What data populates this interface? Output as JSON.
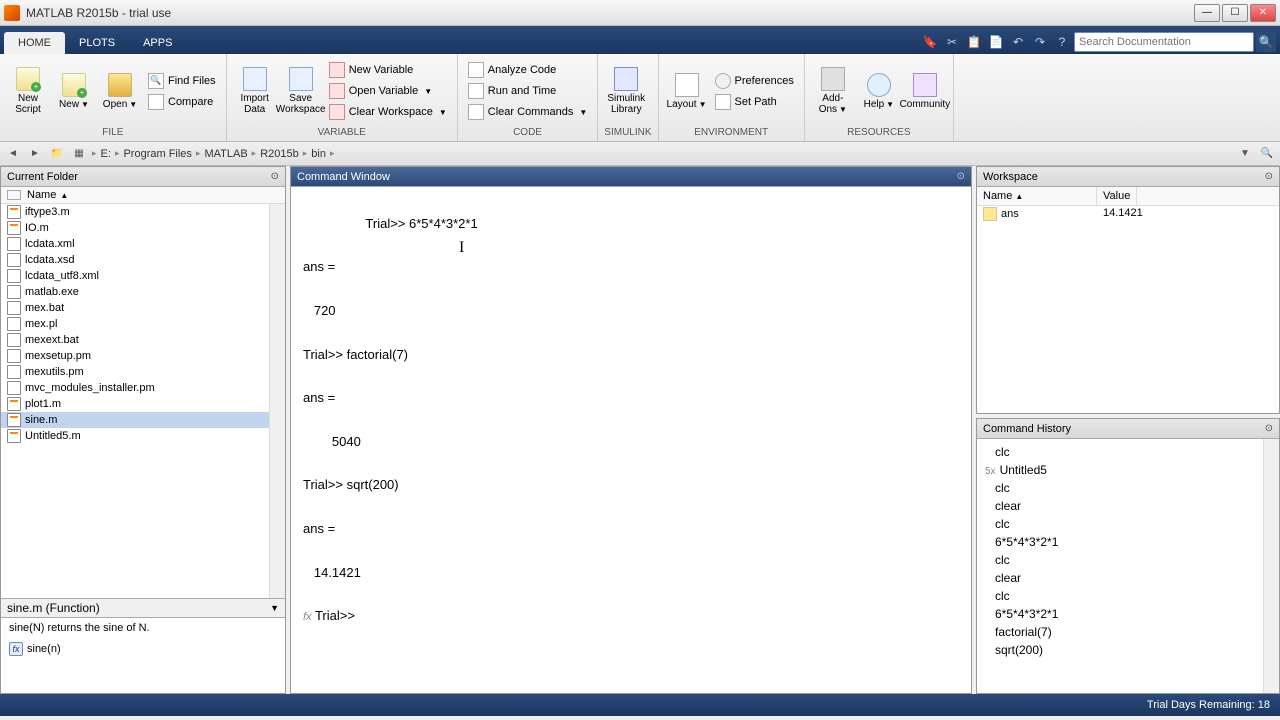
{
  "title": "MATLAB R2015b - trial use",
  "tabs": {
    "home": "HOME",
    "plots": "PLOTS",
    "apps": "APPS"
  },
  "search": {
    "placeholder": "Search Documentation"
  },
  "ribbon": {
    "file": {
      "label": "FILE",
      "new_script": "New\nScript",
      "new": "New",
      "open": "Open",
      "find_files": "Find Files",
      "compare": "Compare"
    },
    "variable": {
      "label": "VARIABLE",
      "import": "Import\nData",
      "save": "Save\nWorkspace",
      "new_var": "New Variable",
      "open_var": "Open Variable",
      "clear_ws": "Clear Workspace"
    },
    "code": {
      "label": "CODE",
      "analyze": "Analyze Code",
      "run_time": "Run and Time",
      "clear_cmd": "Clear Commands"
    },
    "simulink": {
      "label": "SIMULINK",
      "lib": "Simulink\nLibrary"
    },
    "env": {
      "label": "ENVIRONMENT",
      "layout": "Layout",
      "prefs": "Preferences",
      "set_path": "Set Path"
    },
    "resources": {
      "label": "RESOURCES",
      "addons": "Add-Ons",
      "help": "Help",
      "community": "Community"
    }
  },
  "path": {
    "drive": "E:",
    "p1": "Program Files",
    "p2": "MATLAB",
    "p3": "R2015b",
    "p4": "bin"
  },
  "current_folder": {
    "title": "Current Folder",
    "name_col": "Name",
    "files": [
      {
        "n": "iftype3.m"
      },
      {
        "n": "IO.m"
      },
      {
        "n": "lcdata.xml"
      },
      {
        "n": "lcdata.xsd"
      },
      {
        "n": "lcdata_utf8.xml"
      },
      {
        "n": "matlab.exe"
      },
      {
        "n": "mex.bat"
      },
      {
        "n": "mex.pl"
      },
      {
        "n": "mexext.bat"
      },
      {
        "n": "mexsetup.pm"
      },
      {
        "n": "mexutils.pm"
      },
      {
        "n": "mvc_modules_installer.pm"
      },
      {
        "n": "plot1.m"
      },
      {
        "n": "sine.m",
        "sel": true
      },
      {
        "n": "Untitled5.m"
      }
    ],
    "details_header": "sine.m  (Function)",
    "details_desc": "sine(N) returns the sine of N.",
    "details_sig": "sine(n)"
  },
  "command_window": {
    "title": "Command Window",
    "lines": "Trial>> 6*5*4*3*2*1\n\nans =\n\n   720\n\nTrial>> factorial(7)\n\nans =\n\n        5040\n\nTrial>> sqrt(200)\n\nans =\n\n   14.1421\n\n   Trial>> ",
    "fx_prefix": "fx"
  },
  "workspace": {
    "title": "Workspace",
    "name_col": "Name",
    "value_col": "Value",
    "vars": [
      {
        "name": "ans",
        "value": "14.1421"
      }
    ]
  },
  "history": {
    "title": "Command History",
    "items": [
      {
        "t": "clc"
      },
      {
        "t": "Untitled5",
        "p": "5x"
      },
      {
        "t": "clc"
      },
      {
        "t": "clear"
      },
      {
        "t": "clc"
      },
      {
        "t": "6*5*4*3*2*1"
      },
      {
        "t": "clc"
      },
      {
        "t": "clear"
      },
      {
        "t": "clc"
      },
      {
        "t": "6*5*4*3*2*1"
      },
      {
        "t": "factorial(7)"
      },
      {
        "t": "sqrt(200)"
      }
    ]
  },
  "status": "Trial Days Remaining: 18"
}
